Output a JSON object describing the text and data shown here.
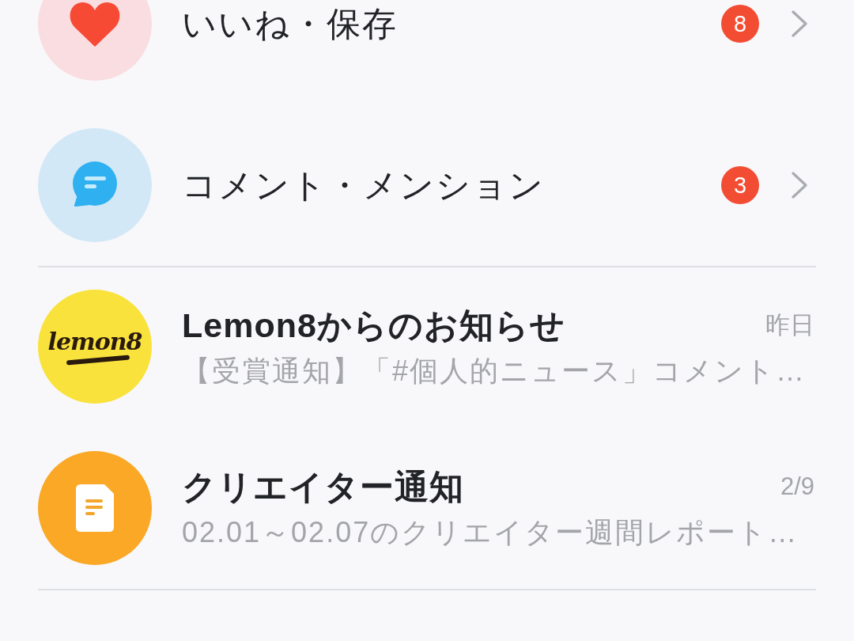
{
  "categories": [
    {
      "kind": "likes",
      "title": "いいね・保存",
      "badge": "8"
    },
    {
      "kind": "comments",
      "title": "コメント・メンション",
      "badge": "3"
    }
  ],
  "messages": [
    {
      "kind": "official",
      "logo": "lemon8",
      "title": "Lemon8からのお知らせ",
      "time": "昨日",
      "preview": "【受賞通知】「#個人的ニュース」コメント…"
    },
    {
      "kind": "creator",
      "title": "クリエイター通知",
      "time": "2/9",
      "preview": "02.01～02.07のクリエイター週間レポート…"
    }
  ]
}
